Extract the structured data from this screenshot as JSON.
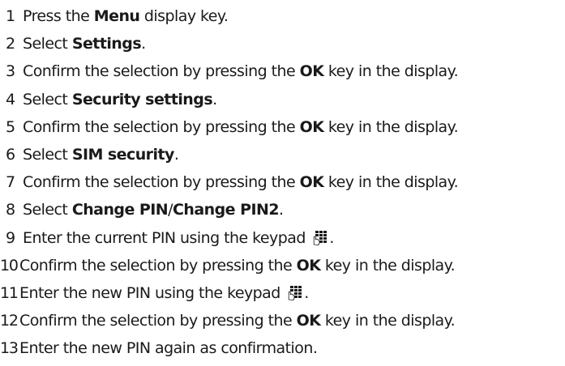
{
  "steps": [
    {
      "num": "1",
      "parts": [
        "Press the ",
        "Menu",
        " display key."
      ]
    },
    {
      "num": "2",
      "parts": [
        "Select ",
        "Settings",
        "."
      ]
    },
    {
      "num": "3",
      "parts": [
        "Confirm the selection by pressing the ",
        "OK",
        " key in the display."
      ]
    },
    {
      "num": "4",
      "parts": [
        "Select ",
        "Security settings",
        "."
      ]
    },
    {
      "num": "5",
      "parts": [
        "Confirm the selection by pressing the ",
        "OK",
        " key in the display."
      ]
    },
    {
      "num": "6",
      "parts": [
        "Select ",
        "SIM security",
        "."
      ]
    },
    {
      "num": "7",
      "parts": [
        "Confirm the selection by pressing the ",
        "OK",
        " key in the display."
      ]
    },
    {
      "num": "8",
      "parts": [
        "Select ",
        "Change PIN",
        "/",
        "Change PIN2",
        "."
      ]
    },
    {
      "num": "9",
      "parts": [
        "Enter the current PIN using the keypad ",
        "",
        "."
      ],
      "icon": "keypad-icon"
    },
    {
      "num": "10",
      "parts": [
        "Confirm the selection by pressing the ",
        "OK",
        " key in the display."
      ]
    },
    {
      "num": "11",
      "parts": [
        "Enter the new PIN using the keypad ",
        "",
        "."
      ],
      "icon": "keypad-icon"
    },
    {
      "num": "12",
      "parts": [
        "Confirm the selection by pressing the ",
        "OK",
        " key in the display."
      ]
    },
    {
      "num": "13",
      "parts": [
        "Enter the new PIN again as confirmation."
      ]
    }
  ],
  "colors": {
    "text": "#1a1a1a",
    "background": "#ffffff"
  }
}
